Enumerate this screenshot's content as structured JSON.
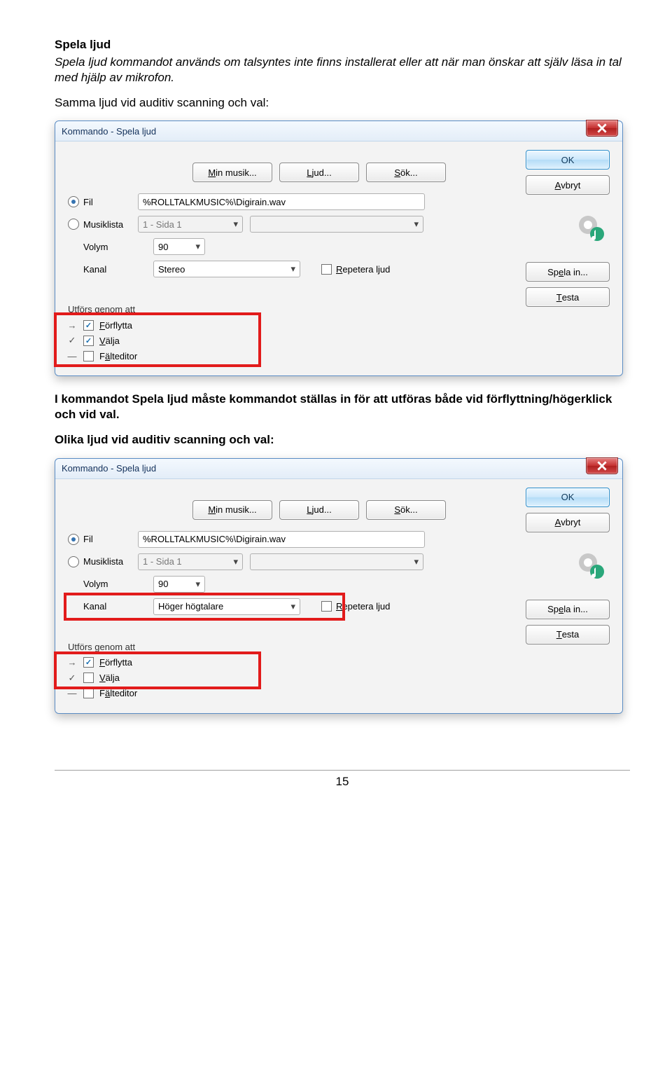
{
  "text": {
    "heading": "Spela ljud",
    "intro": "Spela ljud kommandot används om talsyntes inte finns installerat eller att när man önskar att själv läsa in tal med hjälp av mikrofon.",
    "p1": "Samma ljud vid auditiv scanning och val:",
    "mid": "I kommandot Spela ljud måste kommandot ställas in för att utföras både vid förflyttning/högerklick och vid val.",
    "p2": "Olika ljud vid auditiv scanning och val:",
    "pagenum": "15"
  },
  "dialog": {
    "title": "Kommando - Spela ljud",
    "buttons": {
      "ok": "OK",
      "cancel": "Avbryt",
      "record": "Spela in...",
      "test": "Testa"
    },
    "toolbar": {
      "music": "Min musik...",
      "sound": "Ljud...",
      "search": "Sök..."
    },
    "labels": {
      "fil": "Fil",
      "musiklista": "Musiklista",
      "volym": "Volym",
      "kanal": "Kanal",
      "repetera": "Repetera ljud",
      "utfors": "Utförs genom att",
      "forflytta": "Förflytta",
      "valja": "Välja",
      "falteditor": "Fälteditor"
    },
    "values": {
      "fil": "%ROLLTALKMUSIC%\\Digirain.wav",
      "musiklista": "1 - Sida 1",
      "volym": "90",
      "kanal1": "Stereo",
      "kanal2": "Höger högtalare"
    }
  }
}
